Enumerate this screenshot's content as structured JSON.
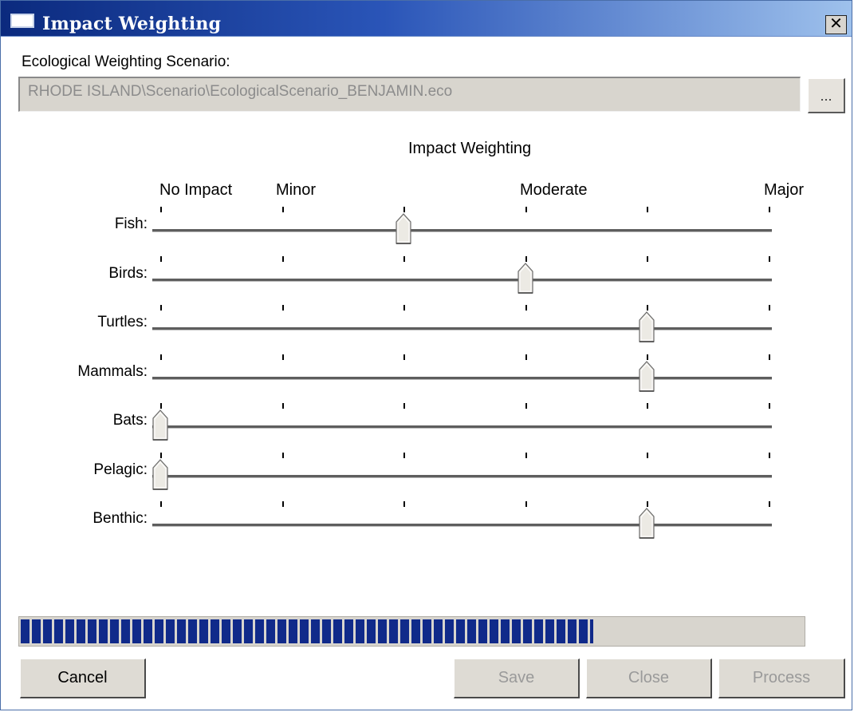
{
  "window": {
    "title": "Impact Weighting",
    "close_glyph": "✕"
  },
  "scenario": {
    "label": "Ecological Weighting Scenario:",
    "path": "RHODE ISLAND\\Scenario\\EcologicalScenario_BENJAMIN.eco",
    "browse_label": "..."
  },
  "weighting": {
    "title": "Impact Weighting",
    "scale_labels": [
      "No Impact",
      "Minor",
      "Moderate",
      "Major"
    ],
    "tick_count": 6,
    "rows": [
      {
        "label": "Fish:",
        "value": 2
      },
      {
        "label": "Birds:",
        "value": 3
      },
      {
        "label": "Turtles:",
        "value": 4
      },
      {
        "label": "Mammals:",
        "value": 4
      },
      {
        "label": "Bats:",
        "value": 0
      },
      {
        "label": "Pelagic:",
        "value": 0
      },
      {
        "label": "Benthic:",
        "value": 4
      }
    ]
  },
  "progress": {
    "fraction": 0.73,
    "color": "#102a8a"
  },
  "buttons": {
    "cancel": "Cancel",
    "save": "Save",
    "close": "Close",
    "process": "Process"
  }
}
